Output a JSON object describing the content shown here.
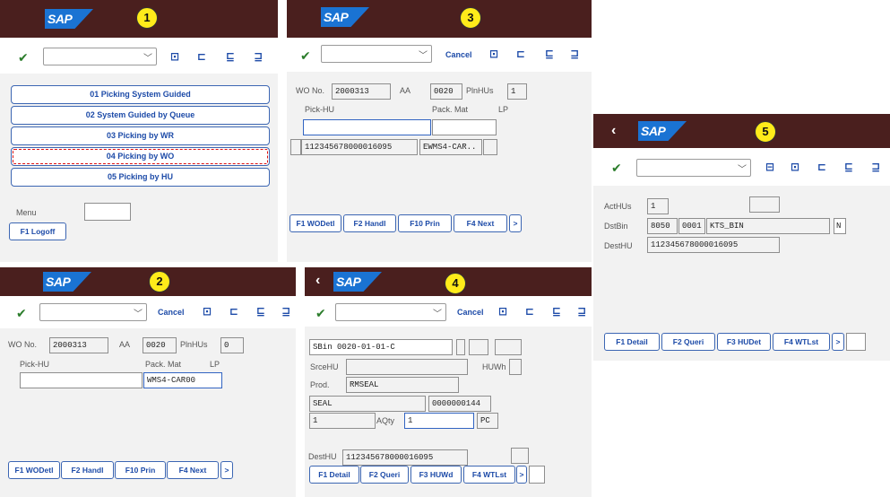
{
  "brand": {
    "logo": "SAP"
  },
  "toolbar": {
    "check_icon": "check-icon",
    "cancel_label": "Cancel",
    "icons": [
      "window-up-icon",
      "window-icon",
      "page-down-icon",
      "page-end-icon"
    ]
  },
  "panel1": {
    "step": "1",
    "menu_items": [
      "01 Picking System Guided",
      "02 System Guided by Queue",
      "03 Picking by WR",
      "04 Picking by WO",
      "05 Picking by HU"
    ],
    "menu_label": "Menu",
    "menu_value": "",
    "logoff_label": "F1 Logoff"
  },
  "panel2": {
    "step": "2",
    "wo_label": "WO No.",
    "wo_value": "2000313",
    "aa_label": "AA",
    "pos_value": "0020",
    "plnhus_label": "PlnHUs",
    "plnhus_value": "0",
    "pickhu_label": "Pick-HU",
    "packmat_label": "Pack. Mat",
    "lp_label": "LP",
    "pickhu_value": "",
    "packmat_value": "WMS4-CAR00",
    "fkeys": [
      "F1 WODetl",
      "F2 Handl",
      "F10 Prin",
      "F4 Next",
      ">"
    ]
  },
  "panel3": {
    "step": "3",
    "wo_label": "WO No.",
    "wo_value": "2000313",
    "aa_label": "AA",
    "pos_value": "0020",
    "plnhus_label": "PlnHUs",
    "plnhus_value": "1",
    "pickhu_label": "Pick-HU",
    "packmat_label": "Pack. Mat",
    "lp_label": "LP",
    "pickhu_value": "",
    "row_hu": "112345678000016095",
    "row_packmat": "EWMS4-CAR..",
    "fkeys": [
      "F1 WODetl",
      "F2 Handl",
      "F10 Prin",
      "F4 Next",
      ">"
    ]
  },
  "panel4": {
    "step": "4",
    "sbin_label": "SBin",
    "sbin_value": "0020-01-01-C",
    "srcehu_label": "SrceHU",
    "huwh_label": "HUWh",
    "prod_label": "Prod.",
    "prod_value": "RMSEAL",
    "desc_value": "SEAL",
    "num_value": "0000000144",
    "qty_value": "1",
    "aqty_label": "AQty",
    "aqty_value": "1",
    "unit_value": "PC",
    "desthu_label": "DestHU",
    "desthu_value": "112345678000016095",
    "fkeys": [
      "F1 Detail",
      "F2 Queri",
      "F3 HUWd",
      "F4 WTLst",
      ">"
    ]
  },
  "panel5": {
    "step": "5",
    "acthus_label": "ActHUs",
    "acthus_value": "1",
    "dstbin_label": "DstBin",
    "dstbin_wh": "8050",
    "dstbin_num": "0001",
    "dstbin_name": "KTS_BIN",
    "dstbin_flag": "N",
    "desthu_label": "DestHU",
    "desthu_value": "112345678000016095",
    "fkeys": [
      "F1 Detail",
      "F2 Queri",
      "F3 HUDet",
      "F4 WTLst",
      ">"
    ]
  }
}
